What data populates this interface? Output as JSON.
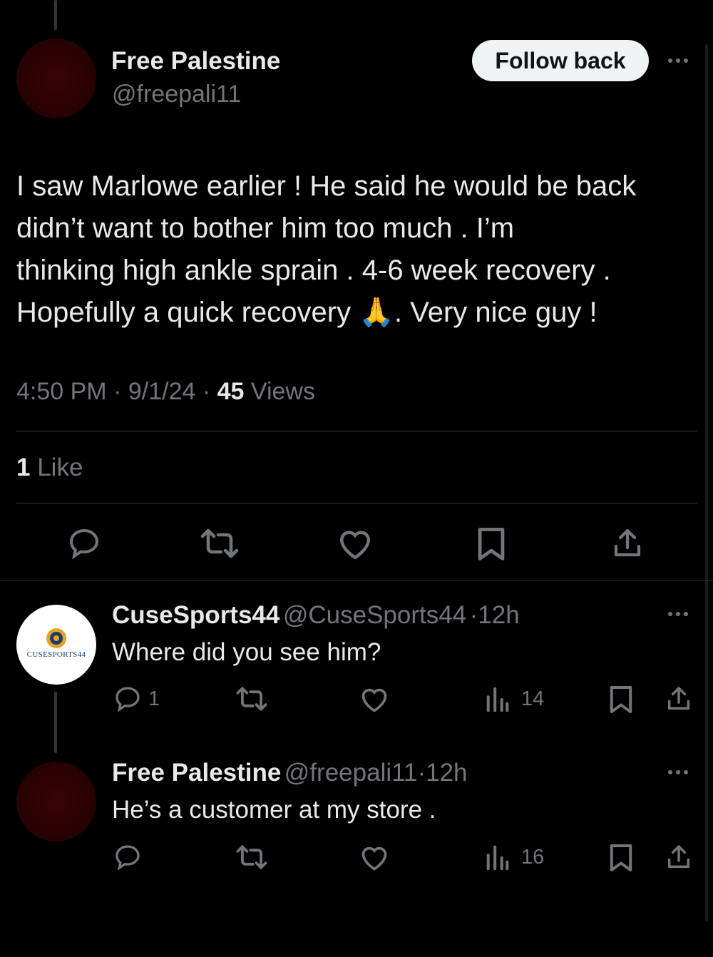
{
  "main_tweet": {
    "author_name": "Free Palestine",
    "author_handle": "@freepali11",
    "follow_label": "Follow back",
    "text_lines": [
      "I saw Marlowe earlier ! He said he would be back",
      "didn’t want to bother him too much  . I’m",
      "thinking high ankle sprain . 4-6 week recovery .",
      "Hopefully a quick recovery 🙏. Very nice guy !"
    ],
    "time": "4:50 PM",
    "date": "9/1/24",
    "separator": "·",
    "views_count": "45",
    "views_label": "Views",
    "likes_count": "1",
    "likes_label": "Like"
  },
  "replies": [
    {
      "author_name": "CuseSports44",
      "author_handle": "@CuseSports44",
      "time": "12h",
      "text": "Where did you see him?",
      "reply_count": "1",
      "views_count": "14",
      "avatar_text": "CUSESPORTS44"
    },
    {
      "author_name": "Free Palestine",
      "author_handle": "@freepali11",
      "time": "12h",
      "text": "He’s a customer at my store .",
      "views_count": "16"
    }
  ],
  "colors": {
    "background": "#000000",
    "text_primary": "#e7e9ea",
    "text_secondary": "#71767b",
    "divider": "#2f3336",
    "follow_button_bg": "#eff3f4",
    "avatar_red": "#2a0202"
  },
  "icons": [
    "reply-icon",
    "retweet-icon",
    "like-icon",
    "bookmark-icon",
    "share-icon",
    "views-icon",
    "more-icon"
  ]
}
